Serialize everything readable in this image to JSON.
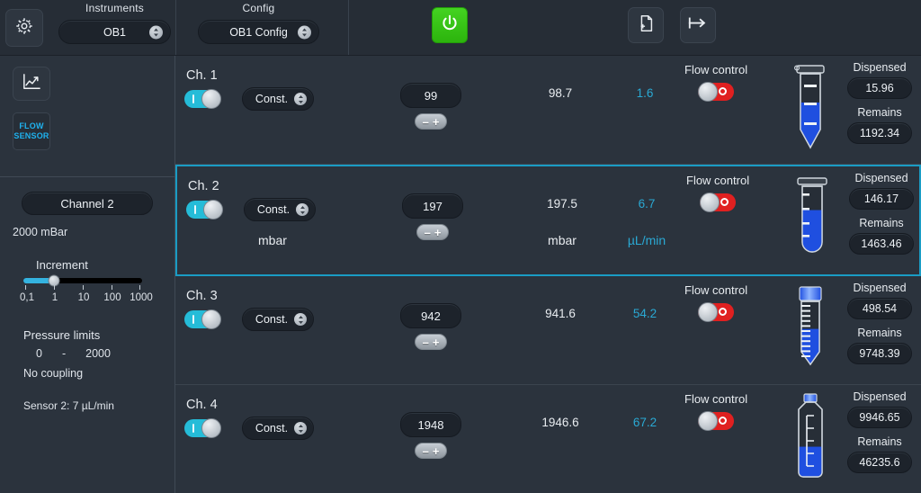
{
  "topbar": {
    "gear_icon": "gear-icon",
    "instruments": {
      "label": "Instruments",
      "value": "OB1"
    },
    "config": {
      "label": "Config",
      "value": "OB1  Config"
    },
    "power_icon": "power-icon",
    "new_file_icon": "new-document-icon",
    "export_icon": "export-arrow-icon"
  },
  "sidebar": {
    "graph_icon": "line-chart-icon",
    "flow_sensor": {
      "line1": "FLOW",
      "line2": "SENSOR"
    },
    "channel_pill": "Channel 2",
    "max_pressure": "2000 mBar",
    "increment": {
      "title": "Increment",
      "ticks": [
        "0,1",
        "1",
        "10",
        "100",
        "1000"
      ],
      "selected_index": 1
    },
    "pressure_limits": {
      "title": "Pressure limits",
      "min": "0",
      "dash": "-",
      "max": "2000"
    },
    "coupling": "No coupling",
    "sensor": "Sensor 2: 7 µL/min"
  },
  "colors": {
    "accent_cyan": "#25bcd8",
    "flow_blue": "#2aa9d4",
    "power_green": "#32c20f",
    "off_red": "#e02020",
    "selection_border": "#1a9cc4",
    "liquid_blue": "#1f4fe0"
  },
  "channels": [
    {
      "name": "Ch. 1",
      "enabled": true,
      "mode": "Const.",
      "setpoint": "99",
      "stepper_minus": "–",
      "stepper_plus": "+",
      "measured": "98.7",
      "measured_unit": "",
      "flow": "1.6",
      "flow_unit": "",
      "flow_control_label": "Flow control",
      "flow_control_on": false,
      "vessel": "eppendorf-tube",
      "fill_percent": 62,
      "dispensed_label": "Dispensed",
      "dispensed": "15.96",
      "remains_label": "Remains",
      "remains": "1192.34"
    },
    {
      "name": "Ch. 2",
      "enabled": true,
      "selected": true,
      "mode": "Const.",
      "setpoint": "197",
      "stepper_minus": "–",
      "stepper_plus": "+",
      "measured": "197.5",
      "measured_unit": "mbar",
      "unit_under_mode": "mbar",
      "flow": "6.7",
      "flow_unit": "µL/min",
      "flow_control_label": "Flow control",
      "flow_control_on": false,
      "vessel": "round-bottom-tube",
      "fill_percent": 66,
      "dispensed_label": "Dispensed",
      "dispensed": "146.17",
      "remains_label": "Remains",
      "remains": "1463.46"
    },
    {
      "name": "Ch. 3",
      "enabled": true,
      "mode": "Const.",
      "setpoint": "942",
      "stepper_minus": "–",
      "stepper_plus": "+",
      "measured": "941.6",
      "measured_unit": "",
      "flow": "54.2",
      "flow_unit": "",
      "flow_control_label": "Flow control",
      "flow_control_on": false,
      "vessel": "falcon-tube",
      "fill_percent": 55,
      "dispensed_label": "Dispensed",
      "dispensed": "498.54",
      "remains_label": "Remains",
      "remains": "9748.39"
    },
    {
      "name": "Ch. 4",
      "enabled": true,
      "mode": "Const.",
      "setpoint": "1948",
      "stepper_minus": "–",
      "stepper_plus": "+",
      "measured": "1946.6",
      "measured_unit": "",
      "flow": "67.2",
      "flow_unit": "",
      "flow_control_label": "Flow control",
      "flow_control_on": false,
      "vessel": "bottle",
      "fill_percent": 44,
      "dispensed_label": "Dispensed",
      "dispensed": "9946.65",
      "remains_label": "Remains",
      "remains": "46235.6"
    }
  ]
}
